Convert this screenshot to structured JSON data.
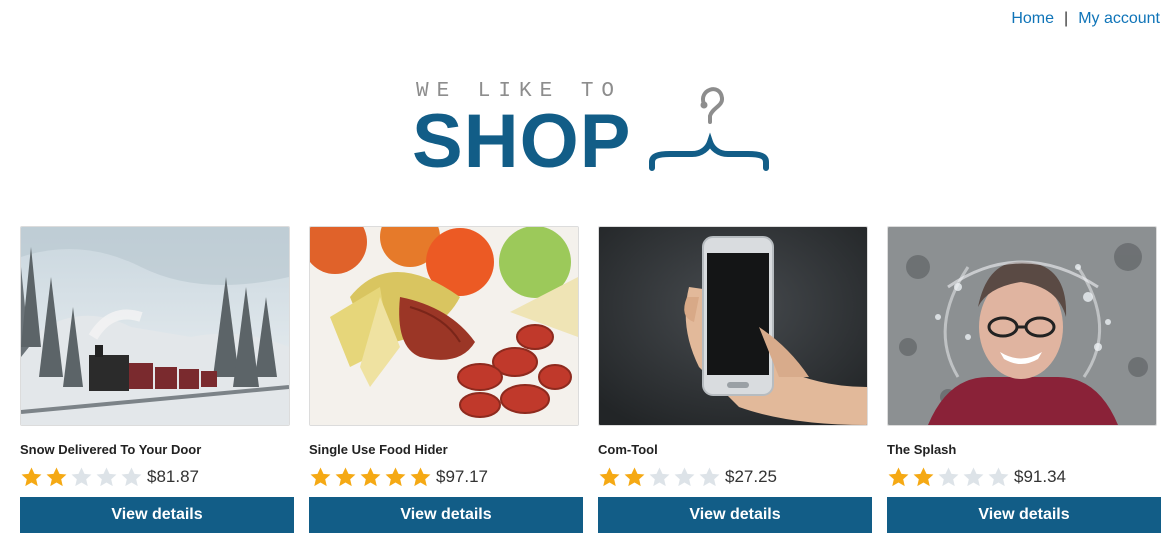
{
  "nav": {
    "home_label": "Home",
    "separator": "|",
    "account_label": "My account",
    "link_color": "#0f74b8"
  },
  "logo": {
    "tagline": "WE LIKE TO",
    "wordmark": "SHOP",
    "icon": "hanger-icon",
    "brand_color": "#125d87"
  },
  "products": [
    {
      "title": "Snow Delivered To Your Door",
      "price": "$81.87",
      "rating": 2,
      "max_rating": 5,
      "button_label": "View details",
      "image": "snowy-steam-train-image"
    },
    {
      "title": "Single Use Food Hider",
      "price": "$97.17",
      "rating": 5,
      "max_rating": 5,
      "button_label": "View details",
      "image": "banana-sausage-image"
    },
    {
      "title": "Com-Tool",
      "price": "$27.25",
      "rating": 2,
      "max_rating": 5,
      "button_label": "View details",
      "image": "hand-holding-phone-image"
    },
    {
      "title": "The Splash",
      "price": "$91.34",
      "rating": 2,
      "max_rating": 5,
      "button_label": "View details",
      "image": "woman-water-splash-image"
    }
  ],
  "colors": {
    "star_filled": "#f5a914",
    "star_empty": "#dde3e8",
    "button_bg": "#125d87"
  }
}
